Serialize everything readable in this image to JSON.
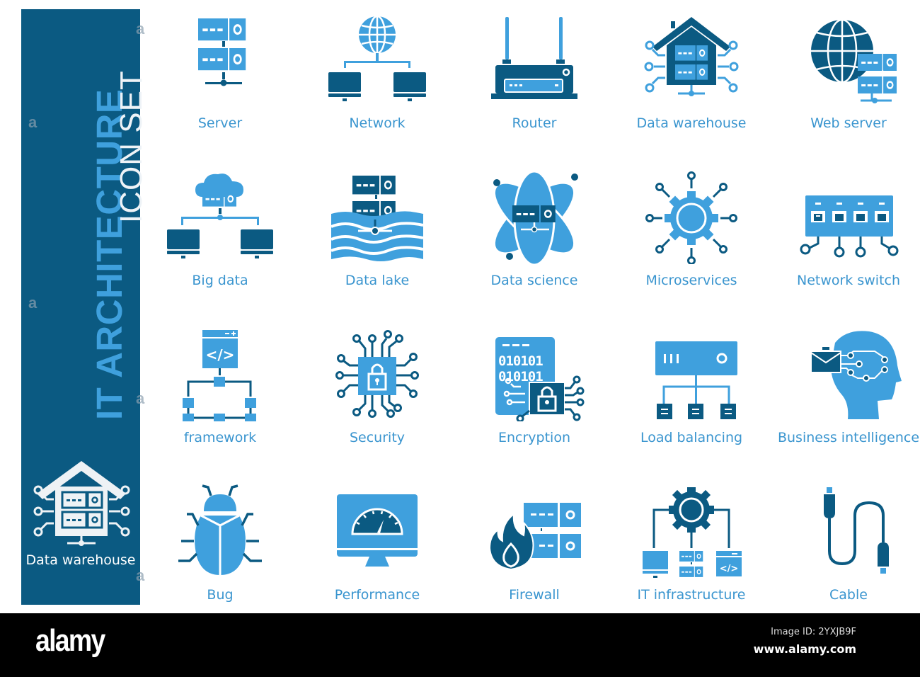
{
  "sidebar": {
    "title_main": "IT ARCHITECTURE",
    "title_sub": "ICON SET",
    "feature_icon": "data-warehouse-icon",
    "feature_label": "Data warehouse"
  },
  "colors": {
    "sidebar_bg": "#0b5a82",
    "light_blue": "#3fa0dd",
    "dark_blue": "#0b5a82",
    "label_blue": "#3a95cf",
    "footer_bg": "#000000"
  },
  "icons": [
    {
      "label": "Server",
      "icon": "server-icon"
    },
    {
      "label": "Network",
      "icon": "network-icon"
    },
    {
      "label": "Router",
      "icon": "router-icon"
    },
    {
      "label": "Data warehouse",
      "icon": "data-warehouse-icon"
    },
    {
      "label": "Web server",
      "icon": "web-server-icon"
    },
    {
      "label": "Big data",
      "icon": "big-data-icon"
    },
    {
      "label": "Data lake",
      "icon": "data-lake-icon"
    },
    {
      "label": "Data science",
      "icon": "data-science-icon"
    },
    {
      "label": "Microservices",
      "icon": "microservices-icon"
    },
    {
      "label": "Network switch",
      "icon": "network-switch-icon"
    },
    {
      "label": "framework",
      "icon": "framework-icon"
    },
    {
      "label": "Security",
      "icon": "security-icon"
    },
    {
      "label": "Encryption",
      "icon": "encryption-icon"
    },
    {
      "label": "Load balancing",
      "icon": "load-balancing-icon"
    },
    {
      "label": "Business intelligence",
      "icon": "business-intelligence-icon"
    },
    {
      "label": "Bug",
      "icon": "bug-icon"
    },
    {
      "label": "Performance",
      "icon": "performance-icon"
    },
    {
      "label": "Firewall",
      "icon": "firewall-icon"
    },
    {
      "label": "IT infrastructure",
      "icon": "it-infrastructure-icon"
    },
    {
      "label": "Cable",
      "icon": "cable-icon"
    }
  ],
  "footer": {
    "logo": "alamy",
    "image_id": "Image ID: 2YXJB9F",
    "site": "www.alamy.com"
  },
  "watermark": "a"
}
